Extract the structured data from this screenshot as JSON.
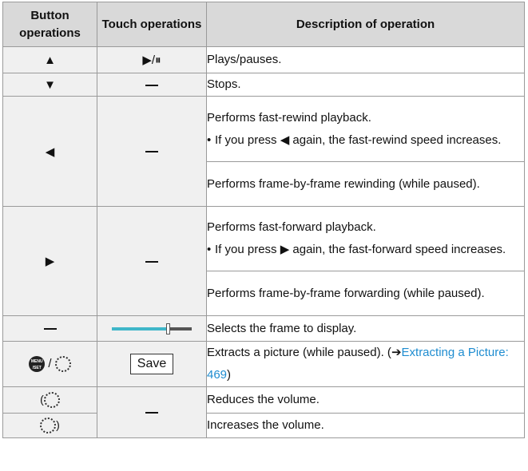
{
  "headers": {
    "button": "Button operations",
    "touch": "Touch operations",
    "description": "Description of operation"
  },
  "rows": {
    "play": {
      "button_symbol": "▲",
      "touch_symbols": "▶/⏸",
      "description": "Plays/pauses."
    },
    "stop": {
      "button_symbol": "▼",
      "description": "Stops."
    },
    "rewind": {
      "button_symbol": "◀",
      "description": "Performs fast-rewind playback.",
      "bullet": "If you press ◀ again, the fast-rewind speed increases.",
      "description2": "Performs frame-by-frame rewinding (while paused)."
    },
    "forward": {
      "button_symbol": "▶",
      "description": "Performs fast-forward playback.",
      "bullet": "If you press ▶ again, the fast-forward speed increases.",
      "description2": "Performs frame-by-frame forwarding (while paused)."
    },
    "select_frame": {
      "description": "Selects the frame to display.",
      "slider_level": 0.7
    },
    "extract": {
      "separator": "/",
      "save_label": "Save",
      "description": "Extracts a picture (while paused). (",
      "arrow": "➔",
      "link": "Extracting a Picture: 469",
      "description_end": ")"
    },
    "volume_down": {
      "description": "Reduces the volume."
    },
    "volume_up": {
      "description": "Increases the volume."
    }
  },
  "icons": {
    "menu_set": "menu-set-button-icon",
    "rear_dial": "rear-dial-icon",
    "dial_left": "control-dial-left-icon",
    "dial_right": "control-dial-right-icon"
  },
  "colors": {
    "header_bg": "#d9d9d9",
    "cell_bg": "#f0f0f0",
    "link": "#1e8cd0",
    "slider_fill": "#3fb6c9"
  }
}
